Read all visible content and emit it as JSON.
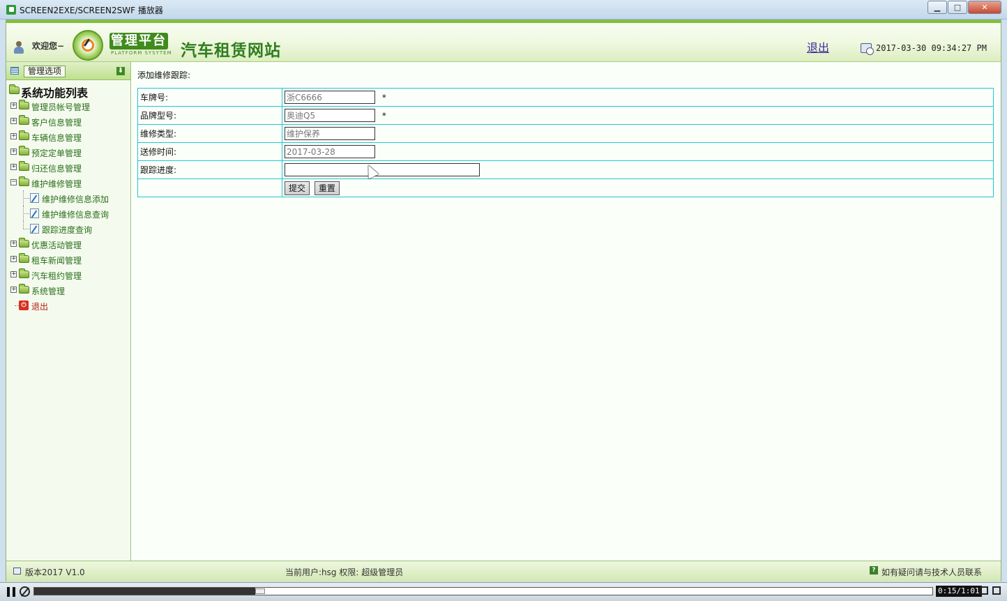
{
  "window": {
    "title": "SCREEN2EXE/SCREEN2SWF 播放器"
  },
  "header": {
    "welcome": "欢迎您−",
    "platform_title": "管理平台",
    "platform_subtitle": "PLATFORM SYSYTEM",
    "site_title": "汽车租赁网站",
    "logout": "退出",
    "datetime": "2017-03-30 09:34:27 PM"
  },
  "sidebar": {
    "options_label": "管理选项",
    "root_label": "系统功能列表",
    "items": [
      {
        "label": "管理员帐号管理"
      },
      {
        "label": "客户信息管理"
      },
      {
        "label": "车辆信息管理"
      },
      {
        "label": "预定定单管理"
      },
      {
        "label": "归还信息管理"
      },
      {
        "label": "维护维修管理",
        "expanded": true,
        "children": [
          {
            "label": "维护维修信息添加"
          },
          {
            "label": "维护维修信息查询"
          },
          {
            "label": "跟踪进度查询"
          }
        ]
      },
      {
        "label": "优惠活动管理"
      },
      {
        "label": "租车新闻管理"
      },
      {
        "label": "汽车租约管理"
      },
      {
        "label": "系统管理"
      }
    ],
    "exit_label": "退出"
  },
  "main": {
    "heading": "添加维修跟踪:",
    "fields": [
      {
        "label": "车牌号:",
        "value": "浙C6666",
        "required": true
      },
      {
        "label": "品牌型号:",
        "value": "奥迪Q5",
        "required": true
      },
      {
        "label": "维修类型:",
        "value": "维护保养"
      },
      {
        "label": "送修时间:",
        "value": "2017-03-28"
      },
      {
        "label": "跟踪进度:",
        "value": ""
      }
    ],
    "required_mark": "*",
    "submit_label": "提交",
    "reset_label": "重置"
  },
  "footer": {
    "version": "版本2017 V1.0",
    "current_user": "当前用户:hsg 权限:  超级管理员",
    "help": "如有疑问请与技术人员联系"
  },
  "player": {
    "time": "0:15/1:01",
    "progress_fraction": 0.246
  },
  "colors": {
    "brand_green": "#3f8b1e",
    "table_border": "#27c4cf",
    "link_purple": "#3a2a9a"
  }
}
